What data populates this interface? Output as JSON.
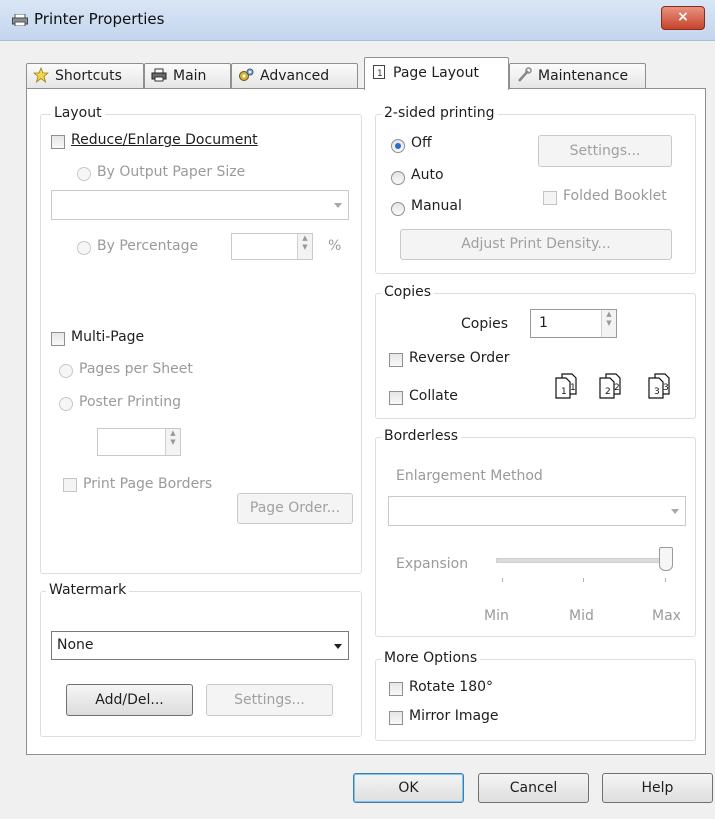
{
  "window": {
    "title": "Printer Properties",
    "close_label": "×"
  },
  "tabs": [
    {
      "label": "Shortcuts",
      "icon": "star-icon"
    },
    {
      "label": "Main",
      "icon": "printer-icon"
    },
    {
      "label": "Advanced",
      "icon": "gears-icon"
    },
    {
      "label": "Page Layout",
      "icon": "page-icon",
      "active": true
    },
    {
      "label": "Maintenance",
      "icon": "wrench-icon"
    }
  ],
  "layout": {
    "group_label": "Layout",
    "reduce_enlarge_label": "Reduce/Enlarge Document",
    "by_output_paper_size": "By Output Paper Size",
    "by_percentage": "By Percentage",
    "percent_unit": "%",
    "multi_page_label": "Multi-Page",
    "pages_per_sheet": "Pages per Sheet",
    "poster_printing": "Poster Printing",
    "print_page_borders": "Print Page Borders",
    "page_order_button": "Page Order..."
  },
  "watermark": {
    "group_label": "Watermark",
    "selected": "None",
    "add_del_button": "Add/Del...",
    "settings_button": "Settings..."
  },
  "two_sided": {
    "group_label": "2-sided printing",
    "off": "Off",
    "auto": "Auto",
    "manual": "Manual",
    "selected": "Off",
    "settings_button": "Settings...",
    "folded_booklet": "Folded Booklet",
    "adjust_density_button": "Adjust Print Density..."
  },
  "copies": {
    "group_label": "Copies",
    "copies_label": "Copies",
    "copies_value": "1",
    "reverse_order": "Reverse Order",
    "collate": "Collate"
  },
  "borderless": {
    "group_label": "Borderless",
    "enlargement_method": "Enlargement Method",
    "expansion": "Expansion",
    "slider_level": "Max",
    "min": "Min",
    "mid": "Mid",
    "max": "Max"
  },
  "more_options": {
    "group_label": "More Options",
    "rotate": "Rotate 180°",
    "mirror": "Mirror Image"
  },
  "buttons": {
    "ok": "OK",
    "cancel": "Cancel",
    "help": "Help"
  }
}
